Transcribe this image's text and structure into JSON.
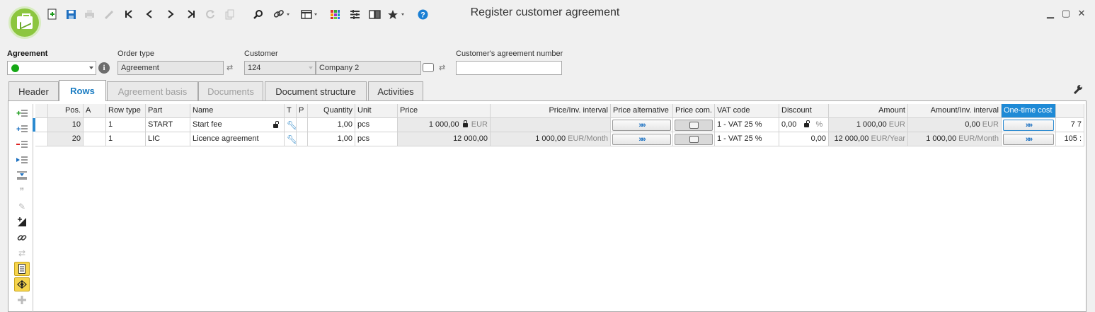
{
  "window": {
    "title": "Register customer agreement",
    "minimize": "▁",
    "maximize": "▢",
    "close": "✕"
  },
  "toolbar": {
    "icons": [
      "new-icon",
      "save-icon",
      "print-icon",
      "edit-icon",
      "first-icon",
      "previous-icon",
      "next-icon",
      "last-icon",
      "refresh-icon",
      "copy-icon",
      "search-icon",
      "link-icon",
      "view-icon",
      "color-icon",
      "filter-icon",
      "book-icon",
      "favorite-icon",
      "help-icon"
    ]
  },
  "form": {
    "agreement_label": "Agreement",
    "order_type_label": "Order type",
    "order_type_value": "Agreement",
    "customer_label": "Customer",
    "customer_number": "124",
    "customer_name": "Company 2",
    "customer_agreement_number_label": "Customer's agreement number",
    "customer_agreement_number_value": "",
    "status_color": "#16a816"
  },
  "tabs": [
    {
      "label": "Header",
      "state": "normal"
    },
    {
      "label": "Rows",
      "state": "active"
    },
    {
      "label": "Agreement basis",
      "state": "disabled"
    },
    {
      "label": "Documents",
      "state": "disabled"
    },
    {
      "label": "Document structure",
      "state": "normal"
    },
    {
      "label": "Activities",
      "state": "normal"
    }
  ],
  "grid": {
    "headers": {
      "pos": "Pos.",
      "a": "A",
      "row_type": "Row type",
      "part": "Part",
      "name": "Name",
      "t": "T",
      "p": "P",
      "quantity": "Quantity",
      "unit": "Unit",
      "price": "Price",
      "price_inv_interval": "Price/Inv. interval",
      "price_alternative": "Price alternative",
      "price_com": "Price com.",
      "vat_code": "VAT code",
      "discount": "Discount",
      "amount": "Amount",
      "amount_inv_interval": "Amount/Inv. interval",
      "one_time_cost": "One-time cost"
    },
    "rows": [
      {
        "pos": "10",
        "a": "",
        "row_type": "1",
        "part": "START",
        "name": "Start fee",
        "quantity": "1,00",
        "unit": "pcs",
        "price": "1 000,00",
        "price_currency": "EUR",
        "price_inv_interval": "",
        "price_inv_unit": "",
        "vat_code": "1 - VAT 25 %",
        "discount": "0,00",
        "discount_unit": "%",
        "amount": "1 000,00",
        "amount_unit": "EUR",
        "amount_inv_interval": "0,00",
        "amount_inv_unit": "EUR",
        "overflow": "7 7"
      },
      {
        "pos": "20",
        "a": "",
        "row_type": "1",
        "part": "LIC",
        "name": "Licence agreement",
        "quantity": "1,00",
        "unit": "pcs",
        "price": "12 000,00",
        "price_currency": "",
        "price_inv_interval": "1 000,00",
        "price_inv_unit": "EUR/Month",
        "vat_code": "1 - VAT 25 %",
        "discount": "0,00",
        "discount_unit": "",
        "amount": "12 000,00",
        "amount_unit": "EUR/Year",
        "amount_inv_interval": "1 000,00",
        "amount_inv_unit": "EUR/Month",
        "overflow": "105 :"
      }
    ],
    "button_glyph": "»»"
  },
  "side_toolbar": {
    "icons": [
      "add-row-icon",
      "insert-row-icon",
      "delete-row-icon",
      "move-row-icon",
      "expand-icon",
      "quote-icon",
      "draw-icon",
      "resize-icon",
      "link-icon",
      "transfer-icon",
      "calculator-icon",
      "code-icon",
      "plus-icon"
    ]
  }
}
